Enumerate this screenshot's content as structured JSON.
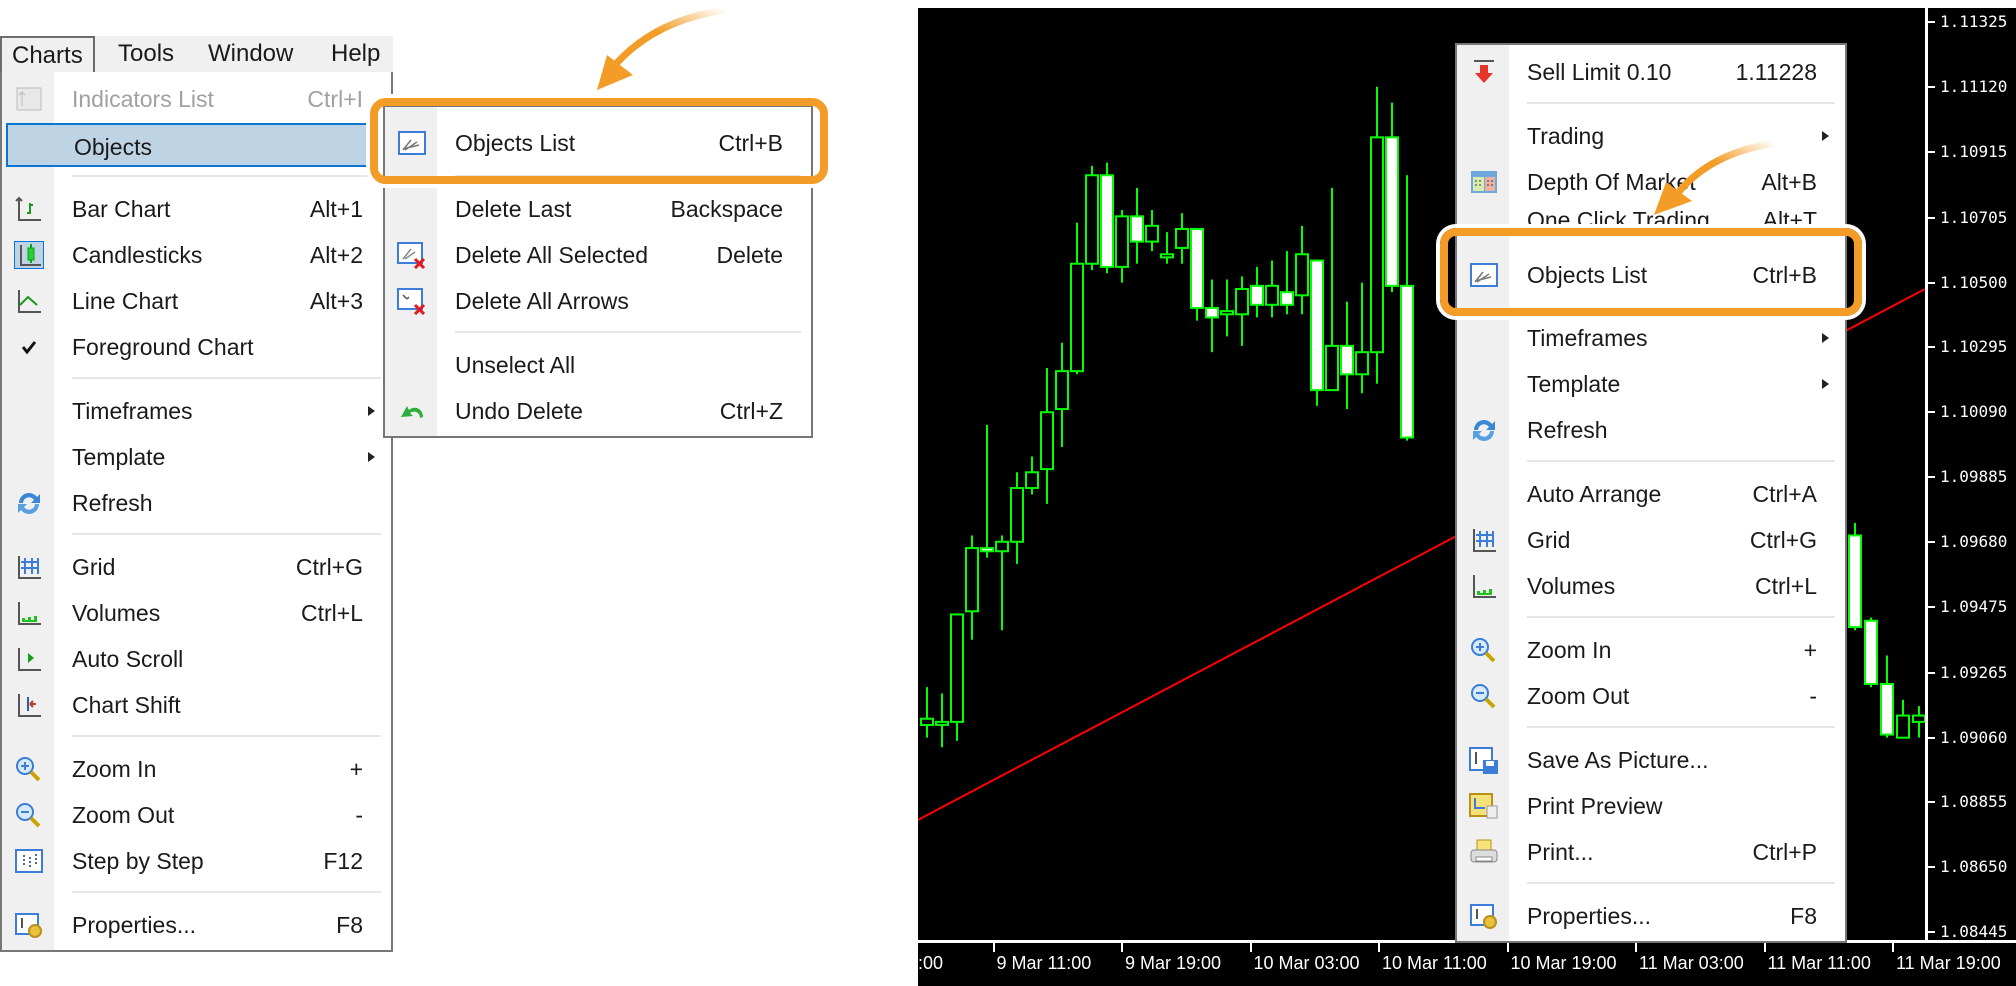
{
  "menubar": {
    "items": [
      "Charts",
      "Tools",
      "Window",
      "Help"
    ]
  },
  "charts_menu": {
    "items": [
      {
        "label": "Indicators List",
        "shortcut": "Ctrl+I",
        "icon": "indicators-list-icon",
        "disabled": true
      },
      {
        "label": "Objects",
        "shortcut": "",
        "icon": "",
        "highlighted": true,
        "submenu": true
      },
      {
        "label": "Bar Chart",
        "shortcut": "Alt+1",
        "icon": "bar-chart-icon"
      },
      {
        "label": "Candlesticks",
        "shortcut": "Alt+2",
        "icon": "candlesticks-icon",
        "checked": true
      },
      {
        "label": "Line Chart",
        "shortcut": "Alt+3",
        "icon": "line-chart-icon"
      },
      {
        "label": "Foreground Chart",
        "shortcut": "",
        "icon": "checkmark-icon"
      },
      {
        "label": "Timeframes",
        "shortcut": "",
        "submenu": true
      },
      {
        "label": "Template",
        "shortcut": "",
        "submenu": true
      },
      {
        "label": "Refresh",
        "shortcut": "",
        "icon": "refresh-icon"
      },
      {
        "label": "Grid",
        "shortcut": "Ctrl+G",
        "icon": "grid-icon"
      },
      {
        "label": "Volumes",
        "shortcut": "Ctrl+L",
        "icon": "volumes-icon"
      },
      {
        "label": "Auto Scroll",
        "shortcut": "",
        "icon": "auto-scroll-icon"
      },
      {
        "label": "Chart Shift",
        "shortcut": "",
        "icon": "chart-shift-icon"
      },
      {
        "label": "Zoom In",
        "shortcut": "+",
        "icon": "zoom-in-icon"
      },
      {
        "label": "Zoom Out",
        "shortcut": "-",
        "icon": "zoom-out-icon"
      },
      {
        "label": "Step by Step",
        "shortcut": "F12",
        "icon": "step-by-step-icon"
      },
      {
        "label": "Properties...",
        "shortcut": "F8",
        "icon": "properties-icon"
      }
    ]
  },
  "objects_submenu": {
    "items": [
      {
        "label": "Objects List",
        "shortcut": "Ctrl+B",
        "icon": "objects-list-icon",
        "emphasized": true
      },
      {
        "label": "Delete Last",
        "shortcut": "Backspace"
      },
      {
        "label": "Delete All Selected",
        "shortcut": "Delete",
        "icon": "delete-selected-icon"
      },
      {
        "label": "Delete All Arrows",
        "shortcut": "",
        "icon": "delete-arrows-icon"
      },
      {
        "label": "Unselect All",
        "shortcut": ""
      },
      {
        "label": "Undo Delete",
        "shortcut": "Ctrl+Z",
        "icon": "undo-icon"
      }
    ]
  },
  "context_menu": {
    "items": [
      {
        "label": "Sell Limit 0.10",
        "shortcut": "1.11228",
        "icon": "sell-limit-icon"
      },
      {
        "label": "Trading",
        "submenu": true
      },
      {
        "label": "Depth Of Market",
        "shortcut": "Alt+B",
        "icon": "depth-of-market-icon"
      },
      {
        "label": "One Click Trading",
        "shortcut": "Alt+T"
      },
      {
        "label": "Objects List",
        "shortcut": "Ctrl+B",
        "icon": "objects-list-icon",
        "emphasized": true
      },
      {
        "label": "Timeframes",
        "submenu": true
      },
      {
        "label": "Template",
        "submenu": true
      },
      {
        "label": "Refresh",
        "icon": "refresh-icon"
      },
      {
        "label": "Auto Arrange",
        "shortcut": "Ctrl+A"
      },
      {
        "label": "Grid",
        "shortcut": "Ctrl+G",
        "icon": "grid-icon"
      },
      {
        "label": "Volumes",
        "shortcut": "Ctrl+L",
        "icon": "volumes-icon"
      },
      {
        "label": "Zoom In",
        "shortcut": "+",
        "icon": "zoom-in-icon"
      },
      {
        "label": "Zoom Out",
        "shortcut": "-",
        "icon": "zoom-out-icon"
      },
      {
        "label": "Save As Picture...",
        "icon": "save-picture-icon"
      },
      {
        "label": "Print Preview",
        "icon": "print-preview-icon"
      },
      {
        "label": "Print...",
        "shortcut": "Ctrl+P",
        "icon": "print-icon"
      },
      {
        "label": "Properties...",
        "shortcut": "F8",
        "icon": "properties-icon"
      }
    ]
  },
  "colors": {
    "highlight_orange": "#f39c27",
    "candle_green": "#00ff00",
    "trendline_red": "#ff0000",
    "chart_bg": "#000000",
    "menu_highlight": "#bed3e4",
    "menu_highlight_border": "#0a74d4"
  },
  "chart_data": {
    "type": "candlestick",
    "symbol_timeframe": "H1",
    "y_ticks": [
      "1.11325",
      "1.11120",
      "1.10915",
      "1.10705",
      "1.10500",
      "1.10295",
      "1.10090",
      "1.09885",
      "1.09680",
      "1.09475",
      "1.09265",
      "1.09060",
      "1.08855",
      "1.08650",
      "1.08445"
    ],
    "x_ticks": [
      ":00",
      "9 Mar 11:00",
      "9 Mar 19:00",
      "10 Mar 03:00",
      "10 Mar 11:00",
      "10 Mar 19:00",
      "11 Mar 03:00",
      "11 Mar 11:00",
      "11 Mar 19:00"
    ],
    "ylim": [
      1.08445,
      1.11325
    ],
    "trendline": {
      "start_price": 1.088,
      "end_price": 1.1048
    },
    "candles": [
      {
        "o": 1.091,
        "h": 1.0922,
        "l": 1.0906,
        "c": 1.0912,
        "bull": true
      },
      {
        "o": 1.0911,
        "h": 1.092,
        "l": 1.0903,
        "c": 1.0911,
        "bull": true
      },
      {
        "o": 1.0911,
        "h": 1.0945,
        "l": 1.0905,
        "c": 1.0945,
        "bull": true
      },
      {
        "o": 1.0946,
        "h": 1.097,
        "l": 1.0937,
        "c": 1.0966,
        "bull": true
      },
      {
        "o": 1.0966,
        "h": 1.1005,
        "l": 1.0963,
        "c": 1.0965,
        "bull": false
      },
      {
        "o": 1.0965,
        "h": 1.097,
        "l": 1.094,
        "c": 1.0968,
        "bull": true
      },
      {
        "o": 1.0968,
        "h": 1.099,
        "l": 1.0961,
        "c": 1.0985,
        "bull": true
      },
      {
        "o": 1.0985,
        "h": 1.0995,
        "l": 1.0983,
        "c": 1.099,
        "bull": true
      },
      {
        "o": 1.0991,
        "h": 1.1023,
        "l": 1.098,
        "c": 1.1009,
        "bull": true
      },
      {
        "o": 1.101,
        "h": 1.1031,
        "l": 1.0998,
        "c": 1.1022,
        "bull": true
      },
      {
        "o": 1.1022,
        "h": 1.1069,
        "l": 1.1021,
        "c": 1.1056,
        "bull": true
      },
      {
        "o": 1.1056,
        "h": 1.1087,
        "l": 1.1054,
        "c": 1.1084,
        "bull": true
      },
      {
        "o": 1.1084,
        "h": 1.1088,
        "l": 1.1053,
        "c": 1.1055,
        "bull": false
      },
      {
        "o": 1.1055,
        "h": 1.1073,
        "l": 1.105,
        "c": 1.1071,
        "bull": true
      },
      {
        "o": 1.1071,
        "h": 1.108,
        "l": 1.1056,
        "c": 1.1063,
        "bull": false
      },
      {
        "o": 1.1063,
        "h": 1.1073,
        "l": 1.106,
        "c": 1.1068,
        "bull": true
      },
      {
        "o": 1.1058,
        "h": 1.1066,
        "l": 1.1056,
        "c": 1.1059,
        "bull": true
      },
      {
        "o": 1.1061,
        "h": 1.1072,
        "l": 1.1056,
        "c": 1.1067,
        "bull": true
      },
      {
        "o": 1.1067,
        "h": 1.1067,
        "l": 1.1038,
        "c": 1.1042,
        "bull": false
      },
      {
        "o": 1.1042,
        "h": 1.1051,
        "l": 1.1028,
        "c": 1.1039,
        "bull": false
      },
      {
        "o": 1.104,
        "h": 1.1051,
        "l": 1.1033,
        "c": 1.1041,
        "bull": true
      },
      {
        "o": 1.104,
        "h": 1.1052,
        "l": 1.103,
        "c": 1.1048,
        "bull": true
      },
      {
        "o": 1.1049,
        "h": 1.1055,
        "l": 1.1039,
        "c": 1.1043,
        "bull": false
      },
      {
        "o": 1.1043,
        "h": 1.1057,
        "l": 1.1039,
        "c": 1.1049,
        "bull": true
      },
      {
        "o": 1.1047,
        "h": 1.106,
        "l": 1.104,
        "c": 1.1043,
        "bull": false
      },
      {
        "o": 1.1046,
        "h": 1.1068,
        "l": 1.104,
        "c": 1.1059,
        "bull": true
      },
      {
        "o": 1.1057,
        "h": 1.1057,
        "l": 1.1011,
        "c": 1.1016,
        "bull": false
      },
      {
        "o": 1.1016,
        "h": 1.108,
        "l": 1.102,
        "c": 1.103,
        "bull": true
      },
      {
        "o": 1.103,
        "h": 1.1044,
        "l": 1.101,
        "c": 1.1021,
        "bull": false
      },
      {
        "o": 1.1021,
        "h": 1.105,
        "l": 1.1015,
        "c": 1.1028,
        "bull": true
      },
      {
        "o": 1.1028,
        "h": 1.1112,
        "l": 1.1018,
        "c": 1.1096,
        "bull": true
      },
      {
        "o": 1.1096,
        "h": 1.1107,
        "l": 1.1047,
        "c": 1.1049,
        "bull": false
      },
      {
        "o": 1.1049,
        "h": 1.1084,
        "l": 1.1,
        "c": 1.1001,
        "bull": false
      }
    ],
    "right_candles": [
      {
        "o": 1.097,
        "h": 1.0974,
        "l": 1.094,
        "c": 1.0941,
        "bull": false
      },
      {
        "o": 1.0943,
        "h": 1.0944,
        "l": 1.0922,
        "c": 1.0923,
        "bull": false
      },
      {
        "o": 1.0923,
        "h": 1.0932,
        "l": 1.0906,
        "c": 1.0907,
        "bull": false
      },
      {
        "o": 1.0906,
        "h": 1.0918,
        "l": 1.0906,
        "c": 1.0913,
        "bull": true
      },
      {
        "o": 1.0911,
        "h": 1.0916,
        "l": 1.0906,
        "c": 1.0913,
        "bull": true
      }
    ]
  }
}
